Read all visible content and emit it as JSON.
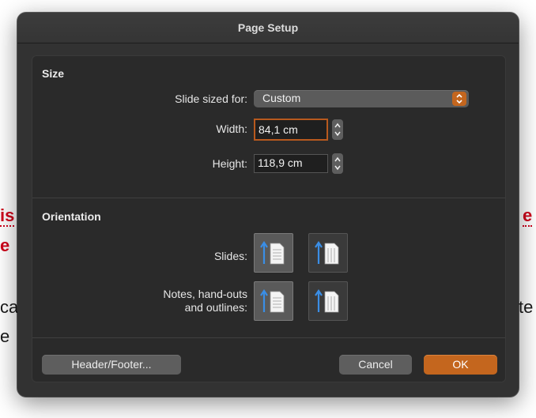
{
  "dialog": {
    "title": "Page Setup"
  },
  "size": {
    "section_title": "Size",
    "slide_sized_for_label": "Slide sized for:",
    "slide_sized_for_value": "Custom",
    "width_label": "Width:",
    "width_value": "84,1 cm",
    "height_label": "Height:",
    "height_value": "118,9 cm"
  },
  "orientation": {
    "section_title": "Orientation",
    "slides_label": "Slides:",
    "notes_label_line1": "Notes, hand-outs",
    "notes_label_line2": "and outlines:",
    "slides_selected": "portrait",
    "notes_selected": "portrait"
  },
  "buttons": {
    "header_footer": "Header/Footer...",
    "cancel": "Cancel",
    "ok": "OK"
  },
  "background_fragments": {
    "left_1": "is",
    "left_2": "e",
    "left_3": "ca",
    "left_4": "e",
    "right_1": "e",
    "right_2": "te"
  },
  "colors": {
    "accent": "#c4661e",
    "dialog_bg": "#323232",
    "panel_bg": "#2a2a2a",
    "doc_red": "#d0021b"
  },
  "icons": {
    "select": "chevron-up-down-icon",
    "stepper": "stepper-arrows-icon",
    "portrait": "portrait-page-icon",
    "landscape": "landscape-page-icon"
  }
}
